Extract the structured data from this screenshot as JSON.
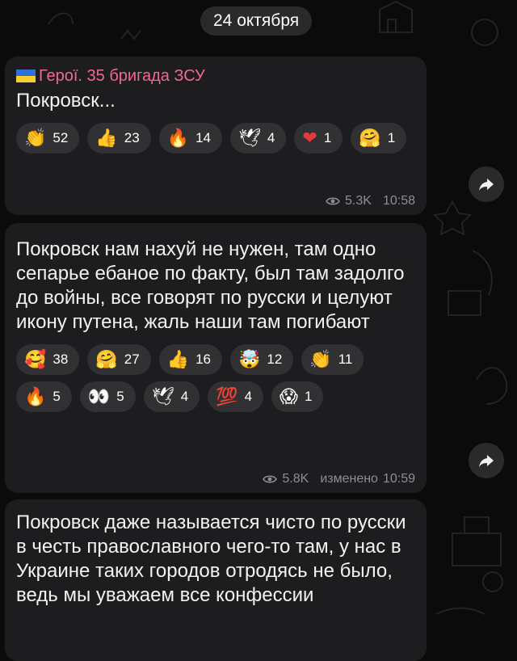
{
  "date_separator": "24 октября",
  "messages": [
    {
      "forward_from": "Герої. 35 бригада ЗСУ",
      "text": "Покровск...",
      "reactions": [
        {
          "emoji": "👏",
          "count": "52"
        },
        {
          "emoji": "👍",
          "count": "23"
        },
        {
          "emoji": "🔥",
          "count": "14"
        },
        {
          "emoji": "🕊",
          "count": "4"
        },
        {
          "emoji": "❤",
          "count": "1"
        },
        {
          "emoji": "🤗",
          "count": "1"
        }
      ],
      "views": "5.3K",
      "edited": "",
      "time": "10:58"
    },
    {
      "text": "Покровск нам нахуй не нужен, там одно сепарье ебаное по факту, был там задолго до войны, все говорят по русски и целуют икону путена, жаль наши там погибают",
      "reactions": [
        {
          "emoji": "🥰",
          "count": "38"
        },
        {
          "emoji": "🤗",
          "count": "27"
        },
        {
          "emoji": "👍",
          "count": "16"
        },
        {
          "emoji": "🤯",
          "count": "12"
        },
        {
          "emoji": "👏",
          "count": "11"
        },
        {
          "emoji": "🔥",
          "count": "5"
        },
        {
          "emoji": "👀",
          "count": "5"
        },
        {
          "emoji": "🕊",
          "count": "4"
        },
        {
          "emoji": "💯",
          "count": "4"
        },
        {
          "emoji": "😱",
          "count": "1"
        }
      ],
      "views": "5.8K",
      "edited": "изменено",
      "time": "10:59"
    },
    {
      "text": "Покровск даже называется чисто по русски в честь православного чего-то там, у нас в Украине таких городов отродясь не было, ведь мы уважаем все конфессии"
    }
  ],
  "icons": {
    "views": "eye-icon",
    "forward": "share-arrow-icon",
    "flag": "ukraine-flag-icon"
  },
  "colors": {
    "background": "#0b0b0c",
    "bubble": "#1d1d1f",
    "chip": "#313134",
    "channel_name": "#f06a8f",
    "meta_text": "#8e8e93",
    "flag_blue": "#2f6fd9",
    "flag_yellow": "#f5cf2b"
  }
}
